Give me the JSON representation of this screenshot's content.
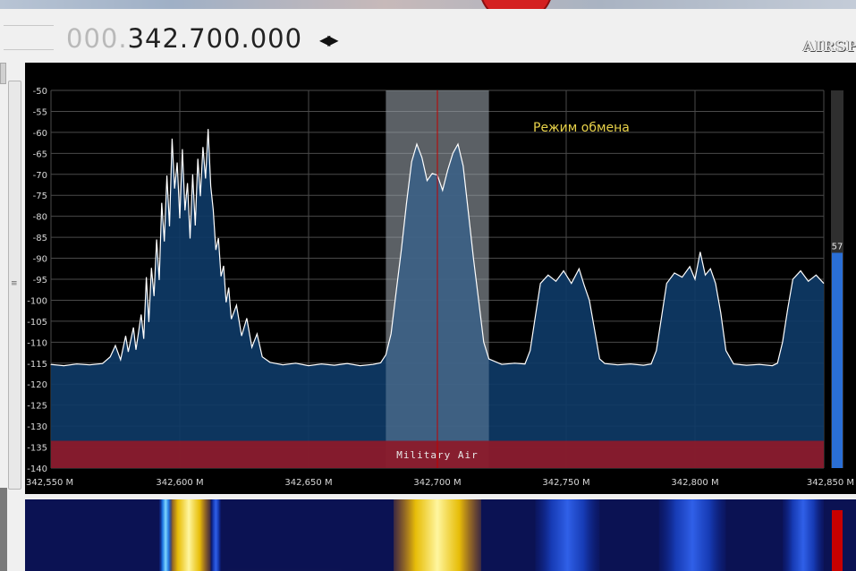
{
  "app": {
    "frequency": {
      "prefix": "000.",
      "main": "342.700.000",
      "tune_icon": "left-right-arrows-icon"
    },
    "logo": "AIRSP"
  },
  "fft": {
    "grid": true,
    "background": "#000000",
    "fill_color": "#0e3a66",
    "trace_color": "#ffffff",
    "center_line_color": "#c00000",
    "bandplan": {
      "label": "Military Air",
      "color": "#8b1a2a"
    },
    "annotation": "Режим обмена",
    "annotation_color": "#e8d24a",
    "signal_meter": {
      "value": 57,
      "label": "57",
      "max": 100,
      "color": "#2a6fd6"
    }
  },
  "chart_data": {
    "type": "line",
    "xlabel": "",
    "ylabel": "",
    "x_unit": "MHz",
    "xlim": [
      342.55,
      342.85
    ],
    "ylim": [
      -140,
      -50
    ],
    "x_ticks": [
      {
        "value": 342.55,
        "label": "342,550 M"
      },
      {
        "value": 342.6,
        "label": "342,600 M"
      },
      {
        "value": 342.65,
        "label": "342,650 M"
      },
      {
        "value": 342.7,
        "label": "342,700 M"
      },
      {
        "value": 342.75,
        "label": "342,750 M"
      },
      {
        "value": 342.8,
        "label": "342,800 M"
      },
      {
        "value": 342.85,
        "label": "342,850 M"
      }
    ],
    "y_ticks": [
      -50,
      -55,
      -60,
      -65,
      -70,
      -75,
      -80,
      -85,
      -90,
      -95,
      -100,
      -105,
      -110,
      -115,
      -120,
      -125,
      -130,
      -135,
      -140
    ],
    "filter_band": [
      342.68,
      342.72
    ],
    "center_frequency": 342.7,
    "bandplan_range": [
      -140,
      -133.5
    ],
    "grid": true,
    "series": [
      {
        "points": [
          [
            342.55,
            -115.3
          ],
          [
            342.555,
            -115.6
          ],
          [
            342.56,
            -115.2
          ],
          [
            342.565,
            -115.4
          ],
          [
            342.57,
            -115.1
          ],
          [
            342.573,
            -113.5
          ],
          [
            342.575,
            -110.8
          ],
          [
            342.577,
            -114.2
          ],
          [
            342.579,
            -108.5
          ],
          [
            342.58,
            -112.3
          ],
          [
            342.582,
            -106.5
          ],
          [
            342.583,
            -111.8
          ],
          [
            342.585,
            -103.4
          ],
          [
            342.586,
            -109.2
          ],
          [
            342.587,
            -94.5
          ],
          [
            342.588,
            -105.2
          ],
          [
            342.589,
            -92.3
          ],
          [
            342.59,
            -99.0
          ],
          [
            342.591,
            -85.5
          ],
          [
            342.592,
            -95.2
          ],
          [
            342.593,
            -76.8
          ],
          [
            342.594,
            -86.0
          ],
          [
            342.595,
            -70.3
          ],
          [
            342.596,
            -82.4
          ],
          [
            342.597,
            -61.5
          ],
          [
            342.598,
            -73.4
          ],
          [
            342.599,
            -67.2
          ],
          [
            342.6,
            -80.5
          ],
          [
            342.601,
            -64.0
          ],
          [
            342.602,
            -78.6
          ],
          [
            342.603,
            -72.1
          ],
          [
            342.604,
            -85.3
          ],
          [
            342.605,
            -70.0
          ],
          [
            342.606,
            -82.2
          ],
          [
            342.607,
            -66.3
          ],
          [
            342.608,
            -75.2
          ],
          [
            342.609,
            -63.5
          ],
          [
            342.61,
            -71.0
          ],
          [
            342.611,
            -59.2
          ],
          [
            342.612,
            -72.8
          ],
          [
            342.613,
            -78.5
          ],
          [
            342.614,
            -88.0
          ],
          [
            342.615,
            -85.2
          ],
          [
            342.616,
            -94.3
          ],
          [
            342.617,
            -91.8
          ],
          [
            342.618,
            -100.5
          ],
          [
            342.619,
            -97.0
          ],
          [
            342.62,
            -104.5
          ],
          [
            342.622,
            -101.2
          ],
          [
            342.624,
            -108.5
          ],
          [
            342.626,
            -104.3
          ],
          [
            342.628,
            -111.2
          ],
          [
            342.63,
            -108.0
          ],
          [
            342.632,
            -113.5
          ],
          [
            342.635,
            -114.8
          ],
          [
            342.64,
            -115.4
          ],
          [
            342.645,
            -115.0
          ],
          [
            342.65,
            -115.6
          ],
          [
            342.655,
            -115.2
          ],
          [
            342.66,
            -115.5
          ],
          [
            342.665,
            -115.1
          ],
          [
            342.67,
            -115.6
          ],
          [
            342.675,
            -115.3
          ],
          [
            342.678,
            -114.9
          ],
          [
            342.68,
            -113.0
          ],
          [
            342.682,
            -108.0
          ],
          [
            342.684,
            -98.0
          ],
          [
            342.686,
            -88.0
          ],
          [
            342.688,
            -77.0
          ],
          [
            342.69,
            -67.0
          ],
          [
            342.692,
            -62.8
          ],
          [
            342.694,
            -66.0
          ],
          [
            342.696,
            -71.5
          ],
          [
            342.698,
            -69.8
          ],
          [
            342.7,
            -70.2
          ],
          [
            342.702,
            -73.8
          ],
          [
            342.704,
            -69.0
          ],
          [
            342.706,
            -65.0
          ],
          [
            342.708,
            -62.8
          ],
          [
            342.71,
            -68.0
          ],
          [
            342.712,
            -79.0
          ],
          [
            342.714,
            -90.0
          ],
          [
            342.716,
            -100.0
          ],
          [
            342.718,
            -110.0
          ],
          [
            342.72,
            -114.0
          ],
          [
            342.725,
            -115.3
          ],
          [
            342.73,
            -115.0
          ],
          [
            342.734,
            -115.2
          ],
          [
            342.736,
            -112.0
          ],
          [
            342.738,
            -104.0
          ],
          [
            342.74,
            -96.0
          ],
          [
            342.743,
            -94.0
          ],
          [
            342.746,
            -95.5
          ],
          [
            342.749,
            -93.0
          ],
          [
            342.752,
            -96.0
          ],
          [
            342.755,
            -92.5
          ],
          [
            342.757,
            -96.5
          ],
          [
            342.759,
            -100.0
          ],
          [
            342.761,
            -107.0
          ],
          [
            342.763,
            -114.0
          ],
          [
            342.765,
            -115.1
          ],
          [
            342.77,
            -115.4
          ],
          [
            342.775,
            -115.2
          ],
          [
            342.78,
            -115.5
          ],
          [
            342.783,
            -115.2
          ],
          [
            342.785,
            -112.0
          ],
          [
            342.787,
            -104.0
          ],
          [
            342.789,
            -96.0
          ],
          [
            342.792,
            -93.5
          ],
          [
            342.795,
            -94.5
          ],
          [
            342.798,
            -92.0
          ],
          [
            342.8,
            -95.0
          ],
          [
            342.802,
            -88.5
          ],
          [
            342.804,
            -94.0
          ],
          [
            342.806,
            -92.5
          ],
          [
            342.808,
            -96.0
          ],
          [
            342.81,
            -103.0
          ],
          [
            342.812,
            -112.0
          ],
          [
            342.815,
            -115.2
          ],
          [
            342.82,
            -115.5
          ],
          [
            342.825,
            -115.3
          ],
          [
            342.83,
            -115.6
          ],
          [
            342.832,
            -115.0
          ],
          [
            342.834,
            -110.0
          ],
          [
            342.836,
            -102.0
          ],
          [
            342.838,
            -95.0
          ],
          [
            342.841,
            -93.0
          ],
          [
            342.844,
            -95.5
          ],
          [
            342.847,
            -94.0
          ],
          [
            342.85,
            -96.0
          ]
        ]
      }
    ]
  },
  "waterfall": {
    "bands": [
      {
        "from": 342.595,
        "to": 342.612,
        "intensity": 0.95
      },
      {
        "from": 342.592,
        "to": 342.597,
        "intensity": 0.55
      },
      {
        "from": 342.612,
        "to": 342.616,
        "intensity": 0.5
      },
      {
        "from": 342.683,
        "to": 342.717,
        "intensity": 1.0
      },
      {
        "from": 342.738,
        "to": 342.763,
        "intensity": 0.38
      },
      {
        "from": 342.786,
        "to": 342.812,
        "intensity": 0.36
      },
      {
        "from": 342.834,
        "to": 342.85,
        "intensity": 0.34
      }
    ],
    "level_marker_color": "#c80000"
  }
}
